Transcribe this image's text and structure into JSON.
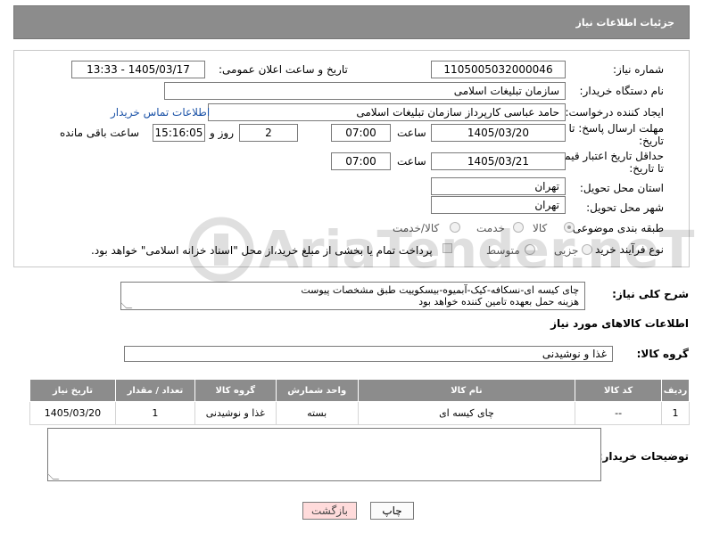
{
  "header": {
    "title": "جزئیات اطلاعات نیاز"
  },
  "form": {
    "need_number_label": "شماره نیاز:",
    "need_number": "1105005032000046",
    "announce_label": "تاریخ و ساعت اعلان عمومی:",
    "announce_value": "1405/03/17 - 13:33",
    "buyer_org_label": "نام دستگاه خریدار:",
    "buyer_org": "سازمان تبلیغات اسلامی",
    "creator_label": "ایجاد کننده درخواست:",
    "creator": "حامد عباسی کارپرداز سازمان تبلیغات اسلامی",
    "contact_link": "اطلاعات تماس خریدار",
    "deadline_label_line1": "مهلت ارسال پاسخ: تا",
    "deadline_label_line2": "تاریخ:",
    "deadline_date": "1405/03/20",
    "time_label": "ساعت",
    "deadline_time": "07:00",
    "days_value": "2",
    "days_label": "روز و",
    "remaining_time": "15:16:05",
    "remaining_label": "ساعت باقی مانده",
    "min_validity_label_line1": "حداقل تاریخ اعتبار قیمت:",
    "min_validity_label_line2": "تا تاریخ:",
    "validity_date": "1405/03/21",
    "validity_time": "07:00",
    "province_label": "استان محل تحویل:",
    "province": "تهران",
    "city_label": "شهر محل تحویل:",
    "city": "تهران",
    "category_label": "طبقه بندی موضوعی:",
    "category_options": [
      "کالا",
      "خدمت",
      "کالا/خدمت"
    ],
    "process_label": "نوع فرآیند خرید :",
    "process_options": [
      "جزیی",
      "متوسط"
    ],
    "payment_note": "پرداخت تمام یا بخشی از مبلغ خرید،از محل \"اسناد خزانه اسلامی\" خواهد بود."
  },
  "description": {
    "label": "شرح کلی نیاز:",
    "line1": "چای کیسه ای-نسکافه-کیک-آبمیوه-بیسکوییت طبق مشخصات پیوست",
    "line2": "هزینه حمل بعهده تامین کننده خواهد بود"
  },
  "goods": {
    "section_title": "اطلاعات کالاهای مورد نیاز",
    "group_label": "گروه کالا:",
    "group_value": "غذا و نوشیدنی"
  },
  "table": {
    "headers": [
      "ردیف",
      "کد کالا",
      "نام کالا",
      "واحد شمارش",
      "گروه کالا",
      "تعداد / مقدار",
      "تاریخ نیاز"
    ],
    "rows": [
      [
        "1",
        "--",
        "چای کیسه ای",
        "بسته",
        "غذا و نوشیدنی",
        "1",
        "1405/03/20"
      ]
    ]
  },
  "notes": {
    "label": "توضیحات خریدار:"
  },
  "buttons": {
    "print": "چاپ",
    "back": "بازگشت"
  },
  "watermark": {
    "text": "AriaTender.neT"
  }
}
